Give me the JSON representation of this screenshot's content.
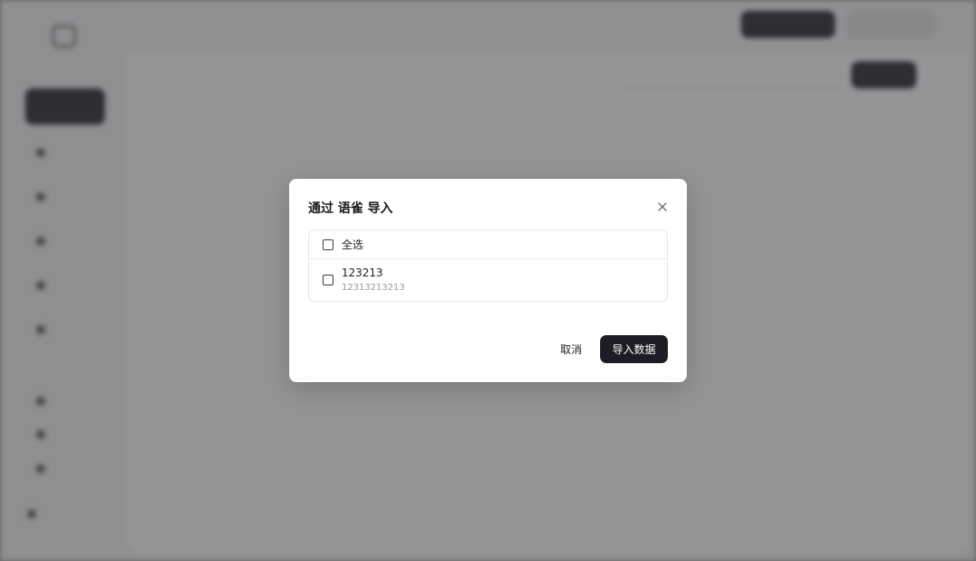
{
  "modal": {
    "title": "通过 语雀 导入",
    "close_icon": "close-icon",
    "select_all_label": "全选",
    "items": [
      {
        "title": "123213",
        "subtitle": "12313213213"
      }
    ],
    "cancel_label": "取消",
    "import_label": "导入数据"
  },
  "colors": {
    "primary_button": "#1d1d26",
    "overlay": "rgba(60,60,64,0.55)",
    "modal_bg": "#ffffff"
  }
}
